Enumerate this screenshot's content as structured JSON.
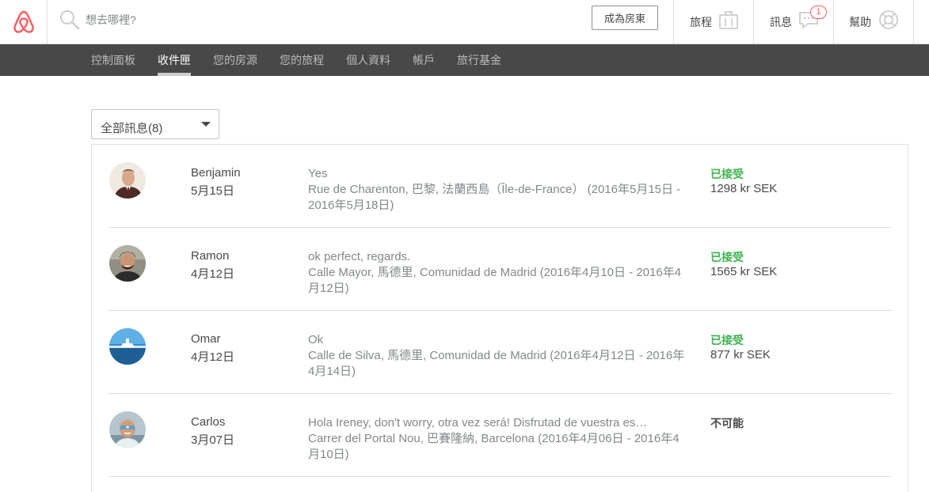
{
  "header": {
    "search_placeholder": "想去哪裡?",
    "host_button": "成為房東",
    "trips_label": "旅程",
    "messages_label": "訊息",
    "messages_badge": "1",
    "help_label": "幫助",
    "colors": {
      "brand": "#ff5a5f",
      "text": "#484848",
      "border": "#dce0e0"
    }
  },
  "subnav": {
    "items": [
      {
        "label": "控制面板"
      },
      {
        "label": "收件匣",
        "active": true
      },
      {
        "label": "您的房源"
      },
      {
        "label": "您的旅程"
      },
      {
        "label": "個人資料"
      },
      {
        "label": "帳戶"
      },
      {
        "label": "旅行基金"
      }
    ]
  },
  "filter": {
    "selected": "全部訊息(8)"
  },
  "threads": [
    {
      "name": "Benjamin",
      "date": "5月15日",
      "message": "Yes",
      "listing": "Rue de Charenton, 巴黎, 法蘭西島（Île-de-France） (2016年5月15日 - 2016年5月18日)",
      "status": "已接受",
      "status_color": "#3fb34f",
      "price": "1298 kr SEK"
    },
    {
      "name": "Ramon",
      "date": "4月12日",
      "message": "ok perfect, regards.",
      "listing": "Calle Mayor, 馬德里, Comunidad de Madrid (2016年4月10日 - 2016年4月12日)",
      "status": "已接受",
      "status_color": "#3fb34f",
      "price": "1565 kr SEK"
    },
    {
      "name": "Omar",
      "date": "4月12日",
      "message": "Ok",
      "listing": "Calle de Silva, 馬德里, Comunidad de Madrid (2016年4月12日 - 2016年4月14日)",
      "status": "已接受",
      "status_color": "#3fb34f",
      "price": "877 kr SEK"
    },
    {
      "name": "Carlos",
      "date": "3月07日",
      "message": "Hola Ireney, don't worry, otra vez será! Disfrutad de vuestra es…",
      "listing": "Carrer del Portal Nou, 巴賽隆納, Barcelona (2016年4月06日 - 2016年4月10日)",
      "status": "不可能",
      "status_color": "#484848",
      "price": ""
    }
  ]
}
